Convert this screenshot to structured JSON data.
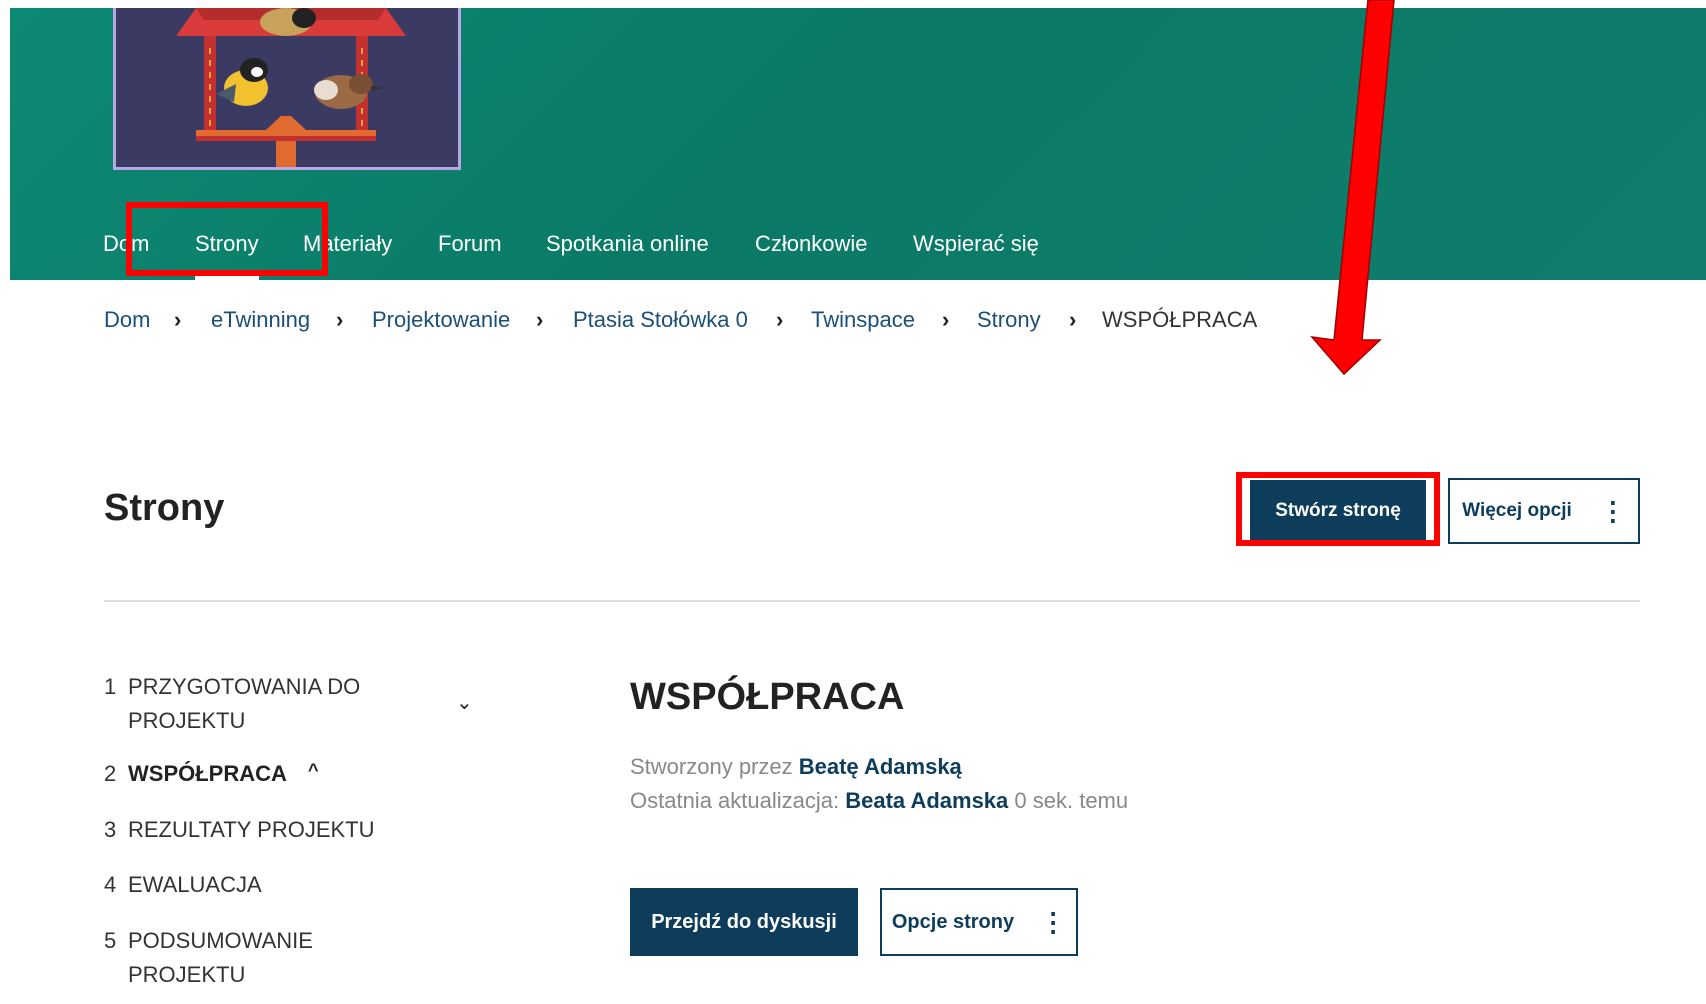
{
  "nav": {
    "items": [
      {
        "label": "Dom"
      },
      {
        "label": "Strony"
      },
      {
        "label": "Materiały"
      },
      {
        "label": "Forum"
      },
      {
        "label": "Spotkania online"
      },
      {
        "label": "Członkowie"
      },
      {
        "label": "Wspierać się"
      }
    ],
    "active": "Strony"
  },
  "breadcrumb": {
    "items": [
      "Dom",
      "eTwinning",
      "Projektowanie",
      "Ptasia Stołówka 0",
      "Twinspace",
      "Strony"
    ],
    "current": "WSPÓŁPRACA"
  },
  "page": {
    "title": "Strony",
    "create_button": "Stwórz stronę",
    "more_options_button": "Więcej opcji"
  },
  "sidebar": {
    "items": [
      {
        "num": "1",
        "label_line1": "PRZYGOTOWANIA DO",
        "label_line2": "PROJEKTU"
      },
      {
        "num": "2",
        "label_line1": "WSPÓŁPRACA"
      },
      {
        "num": "3",
        "label_line1": "REZULTATY PROJEKTU"
      },
      {
        "num": "4",
        "label_line1": "EWALUACJA"
      },
      {
        "num": "5",
        "label_line1": "PODSUMOWANIE",
        "label_line2": "PROJEKTU"
      }
    ]
  },
  "content": {
    "title": "WSPÓŁPRACA",
    "created_by_prefix": "Stworzony przez",
    "created_by": "Beatę Adamską",
    "updated_prefix": "Ostatnia aktualizacja:",
    "updated_by": "Beata Adamska",
    "updated_time": "0 sek. temu",
    "discussion_button": "Przejdź do dyskusji",
    "page_options_button": "Opcje strony"
  },
  "colors": {
    "header": "#0b7d6a",
    "primary": "#0e3d5c",
    "link": "#1a4f7a",
    "annotation": "#ff0000"
  }
}
